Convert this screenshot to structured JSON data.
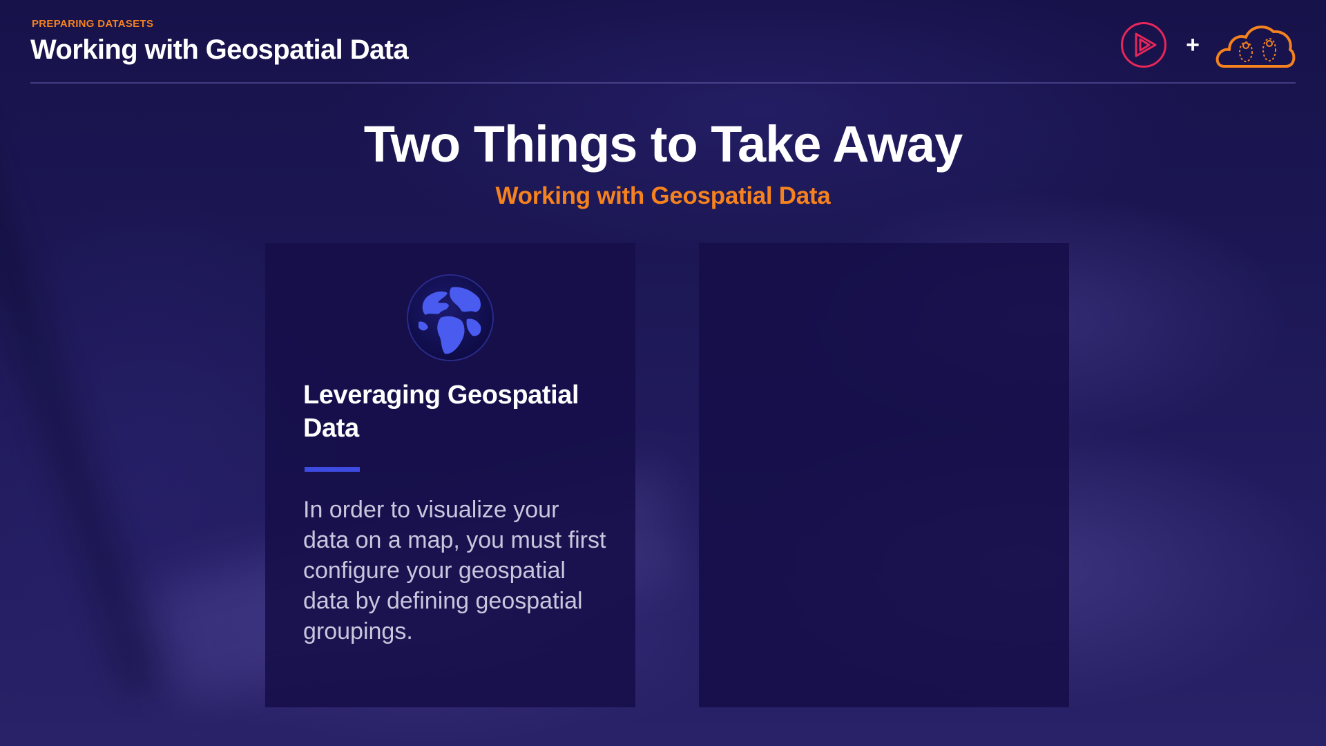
{
  "header": {
    "eyebrow": "PREPARING DATASETS",
    "title": "Working with Geospatial Data",
    "logo_separator": "+",
    "logos": [
      "play-logo-icon",
      "cloud-logo-icon"
    ]
  },
  "slide": {
    "title": "Two Things to Take Away",
    "subtitle": "Working with Geospatial Data"
  },
  "cards": [
    {
      "icon": "globe-icon",
      "heading": "Leveraging Geospatial Data",
      "body": "In order to visualize your data on a map, you must first configure your geospatial data by defining geospatial groupings."
    },
    {
      "icon": "",
      "heading": "",
      "body": ""
    }
  ],
  "colors": {
    "accent_orange": "#f5821f",
    "accent_blue": "#3d4be0",
    "play_logo_red": "#e8265a",
    "background": "#1c1650",
    "card": "#150e48"
  }
}
